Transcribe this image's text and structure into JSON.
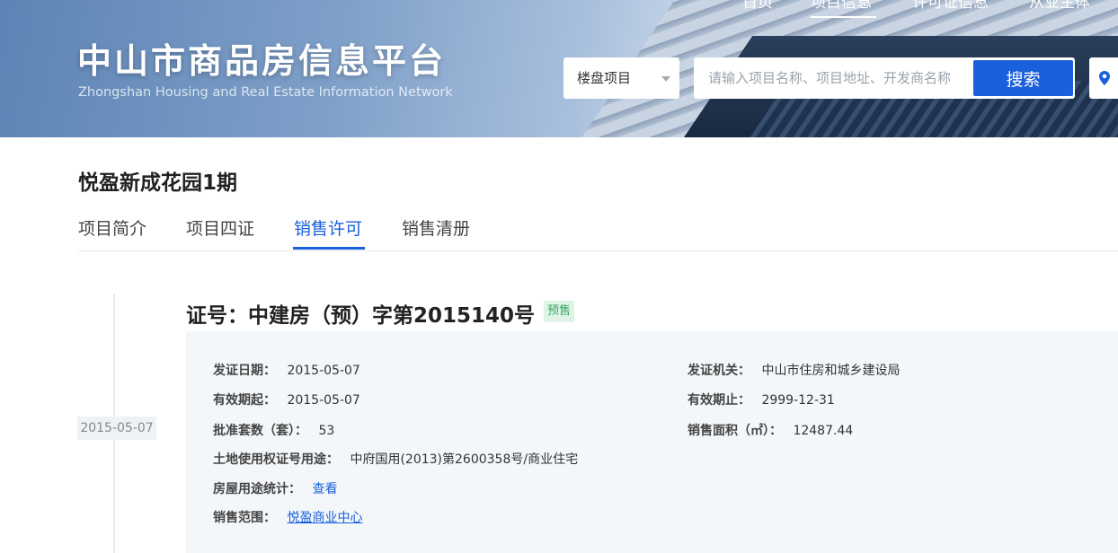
{
  "site": {
    "title": "中山市商品房信息平台",
    "subtitle": "Zhongshan Housing and Real Estate Information Network"
  },
  "top_nav": {
    "items": [
      "首页",
      "项目信息",
      "许可证信息",
      "从业主体"
    ],
    "active_index": 1
  },
  "search": {
    "category": "楼盘项目",
    "placeholder": "请输入项目名称、项目地址、开发商名称",
    "button_label": "搜索"
  },
  "project": {
    "name": "悦盈新成花园1期",
    "tabs": [
      "项目简介",
      "项目四证",
      "销售许可",
      "销售清册"
    ],
    "active_tab_index": 2
  },
  "permit": {
    "timeline_date": "2015-05-07",
    "title": "证号：中建房（预）字第2015140号",
    "status_badge": "预售",
    "fields": {
      "issue_date": {
        "label": "发证日期：",
        "value": "2015-05-07"
      },
      "issuing_office": {
        "label": "发证机关：",
        "value": "中山市住房和城乡建设局"
      },
      "valid_from": {
        "label": "有效期起：",
        "value": "2015-05-07"
      },
      "valid_to": {
        "label": "有效期止：",
        "value": "2999-12-31"
      },
      "approved_units": {
        "label": "批准套数（套）：",
        "value": "53"
      },
      "sales_area": {
        "label": "销售面积（㎡）：",
        "value": "12487.44"
      },
      "land_use_cert": {
        "label": "土地使用权证号用途：",
        "value": "中府国用(2013)第2600358号/商业住宅"
      },
      "usage_stats": {
        "label": "房屋用途统计：",
        "value": "查看"
      },
      "sales_scope": {
        "label": "销售范围：",
        "value": "悦盈商业中心"
      }
    }
  },
  "colors": {
    "accent": "#1a5fdb",
    "badge_bg": "#dff4e6",
    "badge_text": "#3aa564",
    "panel_bg": "#f4f7fa"
  },
  "icons": {
    "map": "location-pin-icon",
    "dropdown": "chevron-down-icon"
  }
}
